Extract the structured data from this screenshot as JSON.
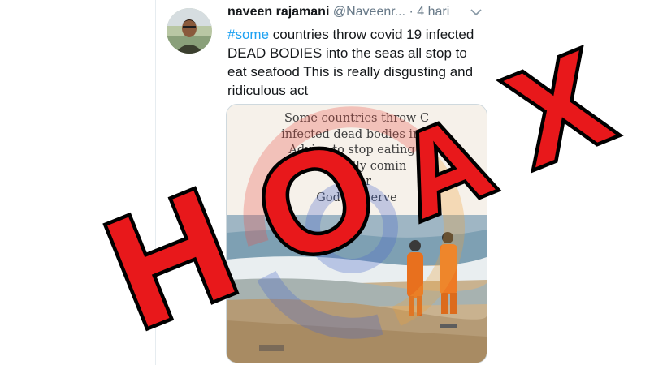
{
  "tweet": {
    "author_name": "naveen rajamani",
    "author_handle": "@Naveenr...",
    "time": "· 4 hari",
    "hashtag": "#some",
    "text": " countries throw covid 19 infected DEAD BODIES into the seas all stop to eat seafood This is really disgusting and ridiculous act"
  },
  "quote_image": {
    "lines": [
      "Some countries throw C",
      "infected dead bodies into",
      "Advice to stop eating s",
      "The V       ally comin",
      "Dear",
      "God      e interve"
    ]
  },
  "overlay": {
    "letters": [
      "H",
      "O",
      "A",
      "X"
    ],
    "color": "#e8181b"
  },
  "colors": {
    "hashtag": "#1da1f2",
    "text": "#14171a",
    "muted": "#657786"
  },
  "icons": [
    "avatar",
    "chevron-down-icon",
    "watermark-logo"
  ]
}
